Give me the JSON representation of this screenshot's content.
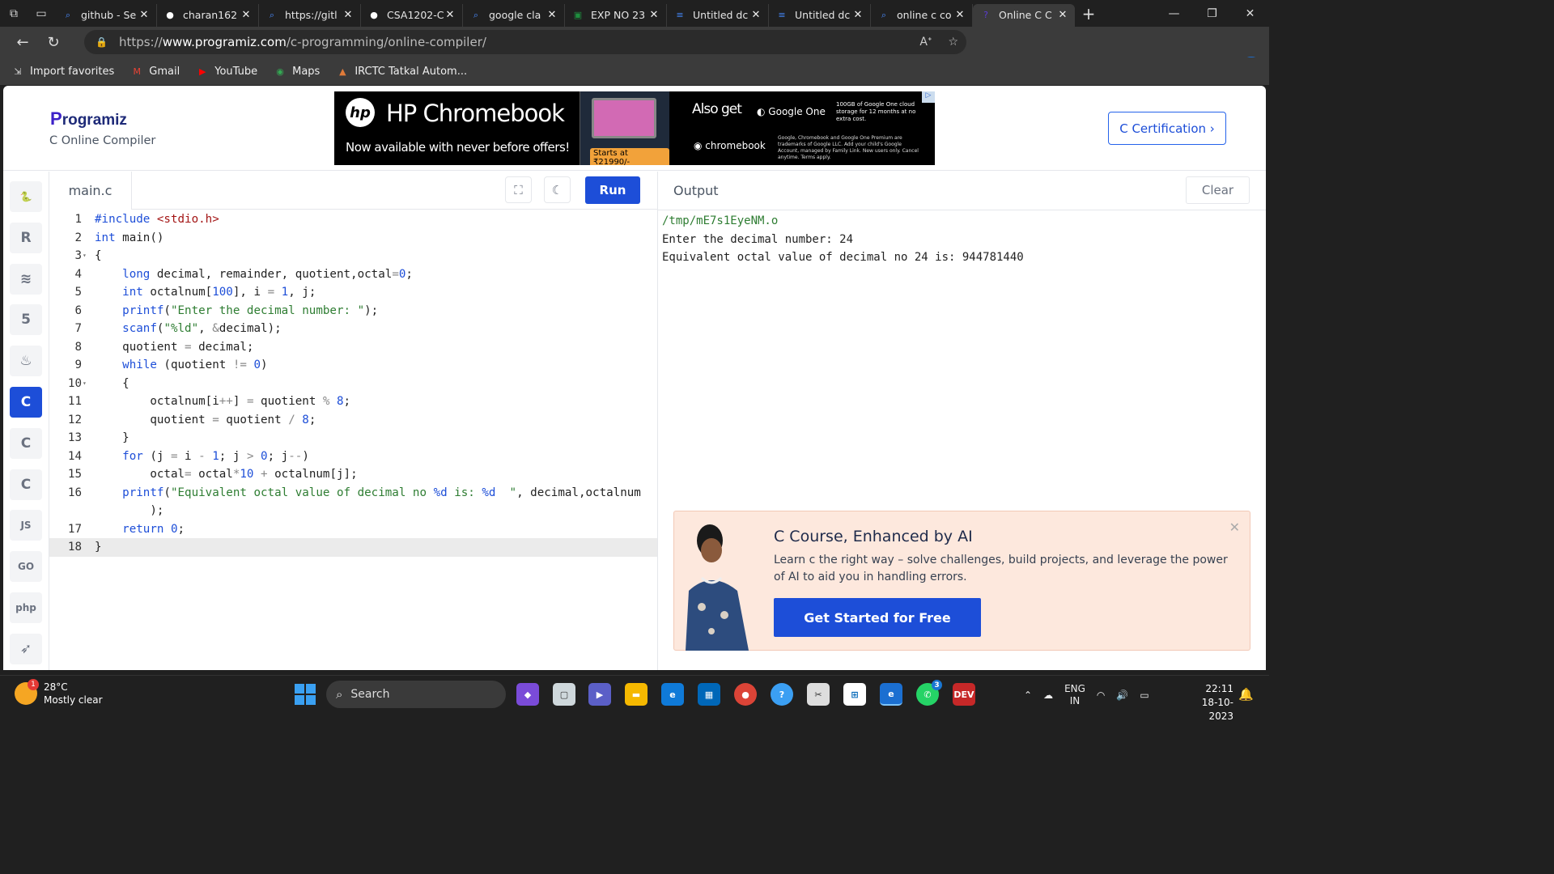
{
  "browser": {
    "tabs": [
      {
        "title": "github - Se",
        "icon": "search-icon",
        "color": "#4a8cff"
      },
      {
        "title": "charan162",
        "icon": "github-icon",
        "color": "#ffffff"
      },
      {
        "title": "https://gitl",
        "icon": "search-icon",
        "color": "#4a8cff"
      },
      {
        "title": "CSA1202-C",
        "icon": "github-icon",
        "color": "#ffffff"
      },
      {
        "title": "google cla",
        "icon": "search-icon",
        "color": "#4a8cff"
      },
      {
        "title": "EXP NO 23",
        "icon": "classroom-icon",
        "color": "#1e8e3e"
      },
      {
        "title": "Untitled dc",
        "icon": "docs-icon",
        "color": "#4285f4"
      },
      {
        "title": "Untitled dc",
        "icon": "docs-icon",
        "color": "#4285f4"
      },
      {
        "title": "online c co",
        "icon": "search-icon",
        "color": "#4a8cff"
      },
      {
        "title": "Online C C",
        "icon": "programiz-icon",
        "color": "#5b3cd6",
        "active": true
      }
    ],
    "url_prefix": "https://",
    "url_host": "www.programiz.com",
    "url_path": "/c-programming/online-compiler/",
    "favorites": [
      {
        "label": "Import favorites",
        "icon": "import-icon"
      },
      {
        "label": "Gmail",
        "icon": "gmail-icon"
      },
      {
        "label": "YouTube",
        "icon": "youtube-icon"
      },
      {
        "label": "Maps",
        "icon": "maps-icon"
      },
      {
        "label": "IRCTC Tatkal Autom...",
        "icon": "irctc-icon"
      }
    ]
  },
  "site": {
    "logo": "rogramiz",
    "logo_initial": "P",
    "subtitle": "C Online Compiler",
    "cert_button": "C Certification ›",
    "ad": {
      "brand": "hp",
      "title": "HP Chromebook",
      "subtitle": "Now available with never before offers!",
      "price": "Starts at ₹21990/-",
      "also_get": "Also get",
      "google_one": "Google One",
      "storage_note": "100GB of Google One cloud storage for 12 months at no extra cost.",
      "chromebook": "chromebook",
      "fine_print": "Google, Chromebook and Google One Premium are trademarks of Google LLC. Add your child's Google Account, managed by Family Link. New users only. Cancel anytime. Terms apply."
    }
  },
  "sidebar": {
    "languages": [
      {
        "name": "python-icon",
        "glyph": "🐍"
      },
      {
        "name": "r-icon",
        "glyph": "R"
      },
      {
        "name": "sql-icon",
        "glyph": "≋"
      },
      {
        "name": "html-icon",
        "glyph": "5"
      },
      {
        "name": "java-icon",
        "glyph": "♨"
      },
      {
        "name": "c-icon",
        "glyph": "C",
        "active": true
      },
      {
        "name": "cpp-icon",
        "glyph": "C"
      },
      {
        "name": "csharp-icon",
        "glyph": "C"
      },
      {
        "name": "js-icon",
        "glyph": "JS"
      },
      {
        "name": "go-icon",
        "glyph": "GO"
      },
      {
        "name": "php-icon",
        "glyph": "php"
      },
      {
        "name": "swift-icon",
        "glyph": "➶"
      }
    ]
  },
  "editor": {
    "file_name": "main.c",
    "run_label": "Run",
    "active_line": 18
  },
  "output": {
    "title": "Output",
    "clear_label": "Clear",
    "lines": [
      "/tmp/mE7s1EyeNM.o",
      "Enter the decimal number: 24",
      "Equivalent octal value of decimal no 24 is: 944781440"
    ]
  },
  "promo": {
    "title": "C Course, Enhanced by AI",
    "description": "Learn c the right way – solve challenges, build projects, and leverage the power of AI to aid you in handling errors.",
    "button": "Get Started for Free"
  },
  "taskbar": {
    "temperature": "28°C",
    "weather": "Mostly clear",
    "weather_badge": "1",
    "search_label": "Search",
    "whatsapp_badge": "3",
    "language_top": "ENG",
    "language_bottom": "IN",
    "time": "22:11",
    "date": "18-10-2023"
  }
}
